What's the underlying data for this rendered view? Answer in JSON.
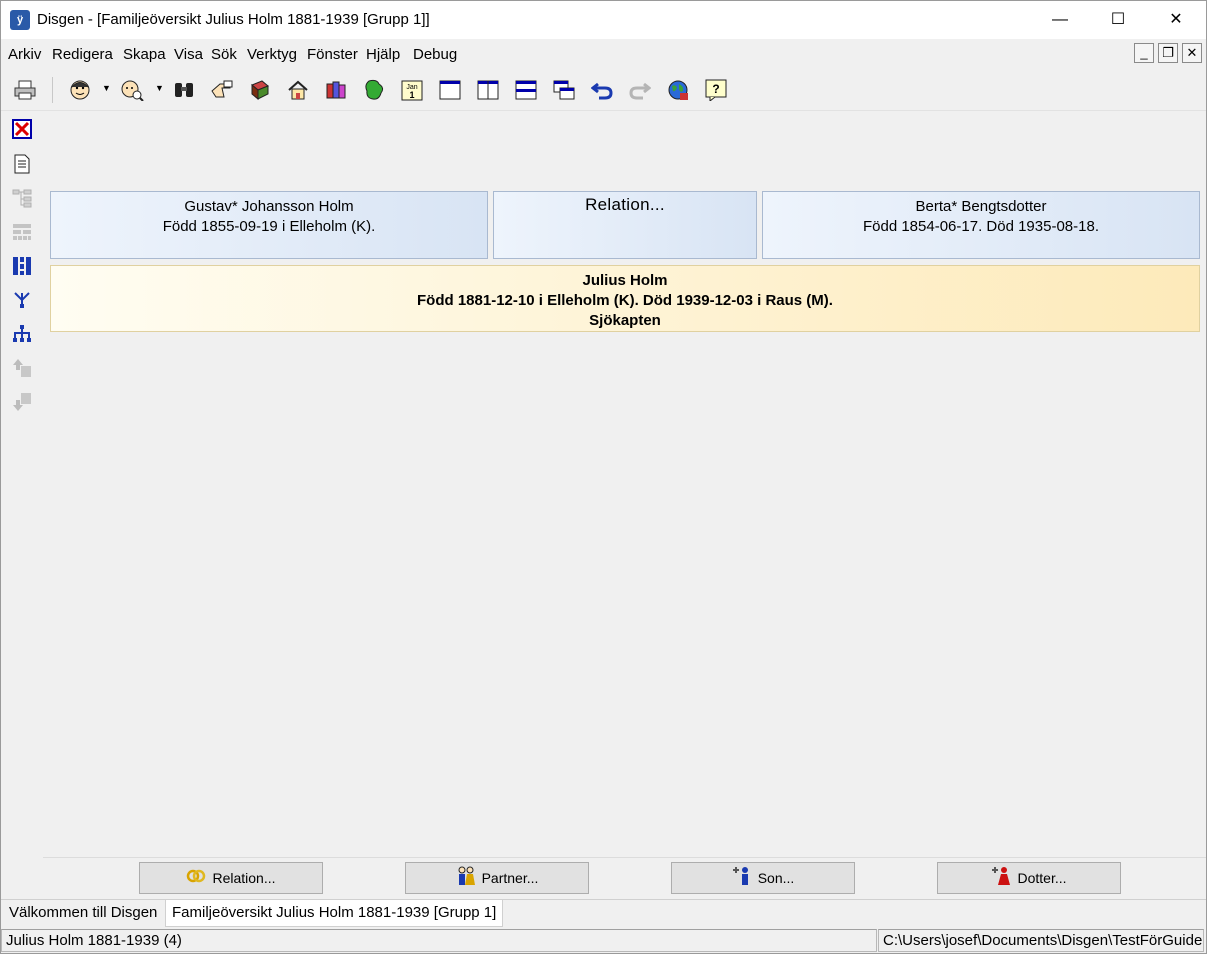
{
  "window": {
    "app_icon": "disgen-app-icon",
    "title": "Disgen - [Familjeöversikt Julius Holm 1881-1939 [Grupp 1]]",
    "controls": {
      "minimize": "—",
      "maximize": "☐",
      "close": "✕"
    }
  },
  "menu": {
    "items": [
      "Arkiv",
      "Redigera",
      "Skapa",
      "Visa",
      "Sök",
      "Verktyg",
      "Fönster",
      "Hjälp",
      "Debug"
    ],
    "mdi_controls": {
      "minimize": "_",
      "restore": "❐",
      "close": "✕"
    }
  },
  "toolbar": {
    "icons": [
      "printer-icon",
      "person-face-icon",
      "person-search-icon",
      "binoculars-icon",
      "pointing-hand-icon",
      "book-icon",
      "home-icon",
      "books-icon",
      "map-icon",
      "calendar-icon",
      "window-single-icon",
      "window-split-vertical-icon",
      "window-split-horizontal-icon",
      "window-cascade-icon",
      "undo-icon",
      "redo-icon",
      "globe-icon",
      "help-icon"
    ],
    "calendar_text": "Jan 1",
    "help_text": "?"
  },
  "sidebar": {
    "icons": [
      "close-red-x-icon",
      "document-icon",
      "tree-disabled-icon",
      "ancestry-chart-disabled-icon",
      "columns-chart-icon",
      "descendant-tree-icon",
      "family-tree-icon",
      "up-arrow-disabled-icon",
      "down-arrow-disabled-icon"
    ]
  },
  "father": {
    "name": "Gustav* Johansson Holm",
    "details": "Född 1855-09-19 i Elleholm (K)."
  },
  "relation_box": {
    "label": "Relation..."
  },
  "mother": {
    "name": "Berta* Bengtsdotter",
    "details": "Född 1854-06-17. Död 1935-08-18."
  },
  "main_person": {
    "name": "Julius Holm",
    "details": "Född 1881-12-10 i Elleholm (K). Död 1939-12-03 i Raus (M).",
    "occupation": "Sjökapten"
  },
  "bottom_buttons": [
    {
      "label": "Relation...",
      "icon": "rings-icon"
    },
    {
      "label": "Partner...",
      "icon": "couple-icon"
    },
    {
      "label": "Son...",
      "icon": "add-son-icon"
    },
    {
      "label": "Dotter...",
      "icon": "add-daughter-icon"
    }
  ],
  "tabs": [
    "Välkommen till Disgen",
    "Familjeöversikt Julius Holm 1881-1939 [Grupp 1]"
  ],
  "status": {
    "left": "Julius Holm 1881-1939 (4)",
    "right": "C:\\Users\\josef\\Documents\\Disgen\\TestFörGuide"
  }
}
